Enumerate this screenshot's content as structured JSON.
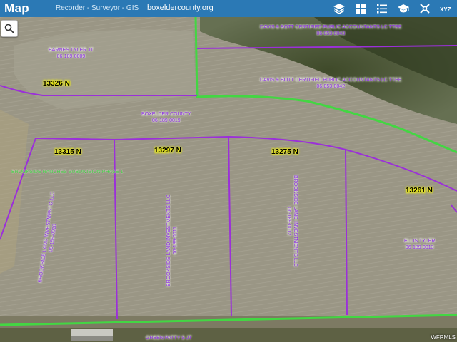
{
  "header": {
    "title": "Map",
    "subtitle": "Recorder - Surveyor - GIS",
    "domain": "boxeldercounty.org"
  },
  "tools": {
    "layers": "layers-icon",
    "basemap": "grid-icon",
    "legend": "list-icon",
    "education": "graduation-cap-icon",
    "tools": "tools-icon",
    "coords": "xyz-icon",
    "coords_label": "XYZ"
  },
  "parcels": {
    "barnes": {
      "owner": "BARNES TYLER JT",
      "id": "06-189-0009"
    },
    "davis1": {
      "owner": "DAVIS & BOTT CERTIFIED PUBLIC ACCOUNTANTS LC TTEE",
      "id": "06-053-0043"
    },
    "davis2": {
      "owner": "DAVIS & BOTT CERTIFIED PUBLIC ACCOUNTANTS LC TTEE",
      "id": "06-053-0042"
    },
    "boxelder": {
      "owner": "BOXELDER COUNTY",
      "id": "06-189-0019"
    },
    "brookside1": {
      "owner": "BROOKSIDE LAND INVESTMENTS LLC",
      "id": "06-189-0010"
    },
    "brookside2": {
      "owner": "BROOKSIDE LAND INVESTMENTS LLC",
      "id": "06-189-0011"
    },
    "brookside3": {
      "owner": "BROOKSIDE LAND INVESTMENTS LLC",
      "id": "06-189-0012"
    },
    "ellis": {
      "owner": "ELLIS TYLER",
      "id": "06-189-0013"
    },
    "green": {
      "owner": "GREEN PATTY S JT"
    }
  },
  "addresses": {
    "a13326": "13326 N",
    "a13315": "13315 N",
    "a13297": "13297 N",
    "a13275": "13275 N",
    "a13261": "13261 N"
  },
  "subdivision": "BROOKSIDE RANCHES SUBDIVISION PHASE 1",
  "watermark": "WFRMLS",
  "colors": {
    "header": "#2b79b5",
    "parcel_line": "#9b30d9",
    "subdivision_line": "#43d643",
    "address_bg": "#ffff00"
  }
}
